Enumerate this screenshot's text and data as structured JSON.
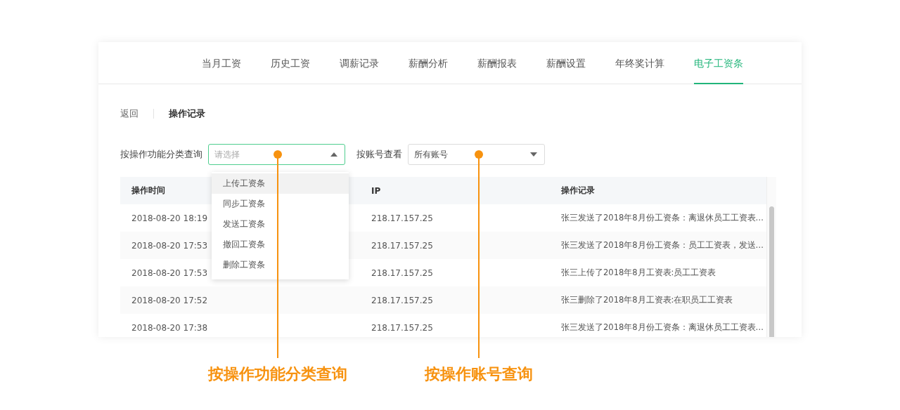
{
  "tabs": [
    {
      "label": "当月工资",
      "selected": false
    },
    {
      "label": "历史工资",
      "selected": false
    },
    {
      "label": "调薪记录",
      "selected": false
    },
    {
      "label": "薪酬分析",
      "selected": false
    },
    {
      "label": "薪酬报表",
      "selected": false
    },
    {
      "label": "薪酬设置",
      "selected": false
    },
    {
      "label": "年终奖计算",
      "selected": false
    },
    {
      "label": "电子工资条",
      "selected": true
    }
  ],
  "breadcrumb": {
    "back": "返回",
    "current": "操作记录"
  },
  "filters": [
    {
      "label": "按操作功能分类查询",
      "placeholder": "请选择",
      "open": true
    },
    {
      "label": "按账号查看",
      "value": "所有账号",
      "open": false
    }
  ],
  "dropdown": {
    "options": [
      {
        "label": "上传工资条",
        "highlighted": true
      },
      {
        "label": "同步工资条",
        "highlighted": false
      },
      {
        "label": "发送工资条",
        "highlighted": false
      },
      {
        "label": "撤回工资条",
        "highlighted": false
      },
      {
        "label": "删除工资条",
        "highlighted": false
      }
    ]
  },
  "table": {
    "columns": [
      "操作时间",
      "IP",
      "操作记录"
    ],
    "rows": [
      [
        "2018-08-20 18:19",
        "218.17.157.25",
        "张三发送了2018年8月份工资条：离退休员工工资表…"
      ],
      [
        "2018-08-20 17:53",
        "218.17.157.25",
        "张三发送了2018年8月份工资条：员工工资表，发送…"
      ],
      [
        "2018-08-20 17:53",
        "218.17.157.25",
        "张三上传了2018年8月工资表:员工工资表"
      ],
      [
        "2018-08-20 17:52",
        "218.17.157.25",
        "张三删除了2018年8月工资表:在职员工工资表"
      ],
      [
        "2018-08-20 17:38",
        "218.17.157.25",
        "张三发送了2018年8月份工资条：离退休员工工资表…"
      ]
    ]
  },
  "annotations": [
    {
      "label": "按操作功能分类查询"
    },
    {
      "label": "按操作账号查询"
    }
  ]
}
